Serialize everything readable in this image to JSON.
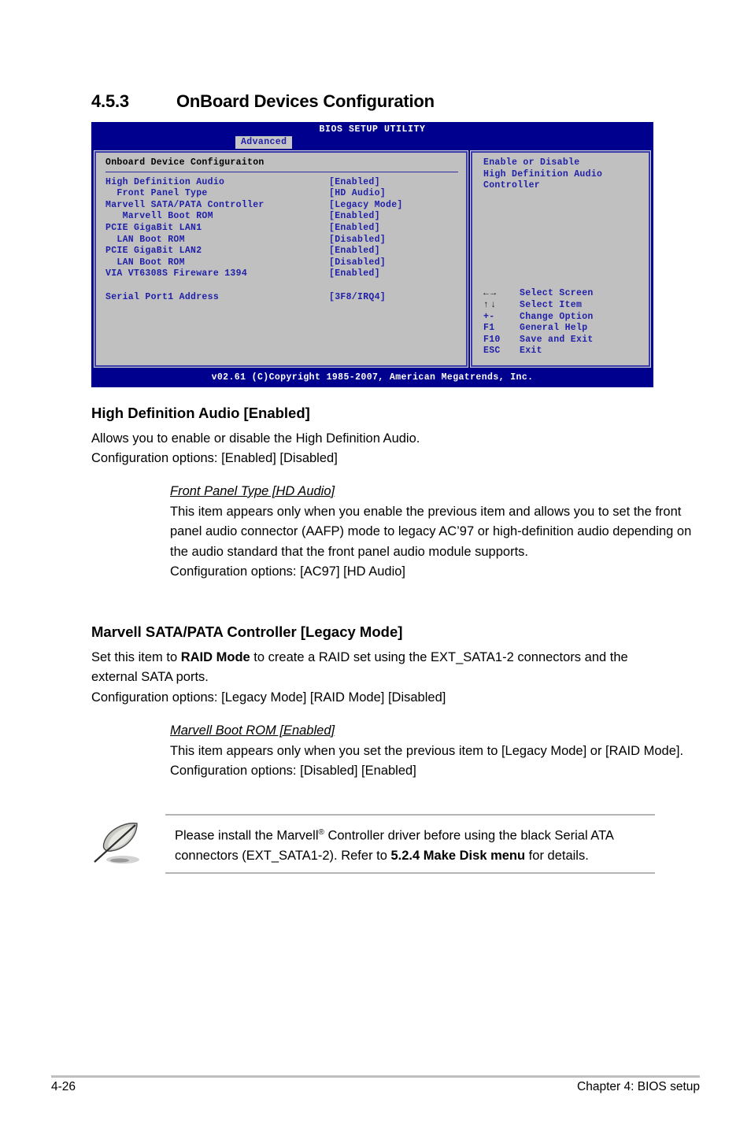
{
  "section": {
    "number": "4.5.3",
    "title": "OnBoard Devices Configuration"
  },
  "bios": {
    "title": "BIOS SETUP UTILITY",
    "tab": "Advanced",
    "panel_header": "Onboard Device Configuraiton",
    "options": [
      {
        "label": "High Definition Audio",
        "value": "[Enabled]"
      },
      {
        "label": "  Front Panel Type",
        "value": "[HD Audio]"
      },
      {
        "label": "Marvell SATA/PATA Controller",
        "value": "[Legacy Mode]"
      },
      {
        "label": "   Marvell Boot ROM",
        "value": "[Enabled]"
      },
      {
        "label": "PCIE GigaBit LAN1",
        "value": "[Enabled]"
      },
      {
        "label": "  LAN Boot ROM",
        "value": "[Disabled]"
      },
      {
        "label": "PCIE GigaBit LAN2",
        "value": "[Enabled]"
      },
      {
        "label": "  LAN Boot ROM",
        "value": "[Disabled]"
      },
      {
        "label": "VIA VT6308S Fireware 1394",
        "value": "[Enabled]"
      },
      {
        "label": "",
        "value": ""
      },
      {
        "label": "Serial Port1 Address",
        "value": "[3F8/IRQ4]"
      }
    ],
    "help": "Enable or Disable\nHigh Definition Audio\nController",
    "legend": [
      {
        "key": "arrows-lr",
        "desc": "Select Screen"
      },
      {
        "key": "arrows-ud",
        "desc": "Select Item"
      },
      {
        "key": "+-",
        "desc": "Change Option"
      },
      {
        "key": "F1",
        "desc": "General Help"
      },
      {
        "key": "F10",
        "desc": "Save and Exit"
      },
      {
        "key": "ESC",
        "desc": "Exit"
      }
    ],
    "footer": "v02.61 (C)Copyright 1985-2007, American Megatrends, Inc.",
    "colors": {
      "chrome_blue": "#00008f",
      "panel_gray": "#c0c0c0",
      "text_blue": "#2020a8"
    }
  },
  "body": {
    "hda": {
      "heading": "High Definition Audio [Enabled]",
      "line1": "Allows you to enable or disable the High Definition Audio.",
      "line2": "Configuration options: [Enabled] [Disabled]"
    },
    "front_panel": {
      "heading": "Front Panel Type [HD Audio]",
      "para": "This item appears only when you enable the previous item and allows you to set the front panel audio connector (AAFP) mode to legacy AC’97 or high-definition audio depending on the audio standard that the front panel audio module supports.",
      "options": "Configuration options: [AC97] [HD Audio]"
    },
    "marvell": {
      "heading": "Marvell SATA/PATA Controller [Legacy Mode]",
      "para_pre": "Set this item to ",
      "para_bold": "RAID Mode",
      "para_post": " to create a RAID set using the EXT_SATA1-2 connectors and the external SATA ports.",
      "options": "Configuration options: [Legacy Mode] [RAID Mode] [Disabled]"
    },
    "marvell_rom": {
      "heading": "Marvell Boot ROM [Enabled]",
      "para": "This item appears only when you set the previous item to [Legacy Mode] or [RAID Mode].",
      "options": "Configuration options: [Disabled] [Enabled]"
    }
  },
  "note": {
    "icon": "quill-pen-icon",
    "line1_pre": "Please install the Marvell",
    "line1_sup": "®",
    "line1_post": " Controller driver before using the black Serial ATA connectors (EXT_SATA1-2). Refer to ",
    "bold_ref": "5.2.4 Make Disk menu",
    "line1_end": " for details."
  },
  "page_footer": {
    "page_number": "4-26",
    "chapter": "Chapter 4: BIOS setup"
  }
}
